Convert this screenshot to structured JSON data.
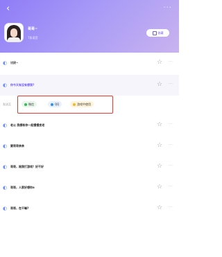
{
  "header": {
    "title": "哥哥~",
    "subtitle": "7条语音",
    "collect_label": "收藏",
    "back_glyph": "‹",
    "more_glyph": "···"
  },
  "colors": {
    "accent": "#6c57f5",
    "highlight_box": "#ea3a2c"
  },
  "icons": {
    "sound": "sound-wave-icon",
    "star": "star-outline-icon",
    "more": "more-dots-icon"
  },
  "list": [
    {
      "text": "讨厌~",
      "highlighted": false
    },
    {
      "text": "你今天有没有想我?",
      "highlighted": true
    },
    {
      "text": "老公 我想和你一起慢慢变老",
      "highlighted": false
    },
    {
      "text": "要哥哥亲亲",
      "highlighted": false
    },
    {
      "text": "哥哥，陪我打游戏？好不好",
      "highlighted": false
    },
    {
      "text": "哥哥，人家好想你a",
      "highlighted": false
    },
    {
      "text": "哥哥，在干嘛?",
      "highlighted": false
    }
  ],
  "share": {
    "label": "发送至",
    "options": [
      "微信",
      "QQ",
      "游戏中使用"
    ]
  }
}
